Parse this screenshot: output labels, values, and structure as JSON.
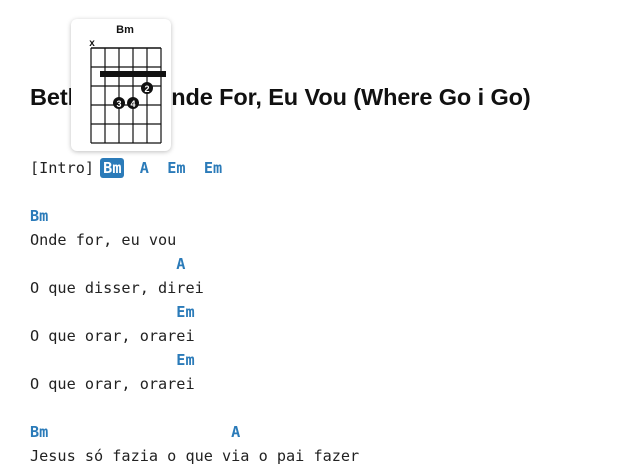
{
  "song": {
    "title": "Beth…ch - Onde For, Eu Vou (Where Go i Go)"
  },
  "intro": {
    "label": "[Intro]",
    "chords": [
      "Bm",
      "A",
      "Em",
      "Em"
    ]
  },
  "lines": [
    {
      "chord_line": "Bm",
      "lyric": "Onde for, eu vou"
    },
    {
      "chord_line": "                A",
      "lyric": "O que disser, direi"
    },
    {
      "chord_line": "                Em",
      "lyric": "O que orar, orarei"
    },
    {
      "chord_line": "                Em",
      "lyric": "O que orar, orarei"
    },
    {
      "chord_line": "Bm                    A",
      "lyric": "Jesus só fazia o que via o pai fazer"
    }
  ],
  "chord_popup": {
    "name": "Bm",
    "muted_marker": "x",
    "fingers": [
      "2",
      "3",
      "4"
    ]
  },
  "colors": {
    "chord": "#2b7bb9",
    "active_chord_bg": "#2b7bb9",
    "text": "#222222"
  }
}
